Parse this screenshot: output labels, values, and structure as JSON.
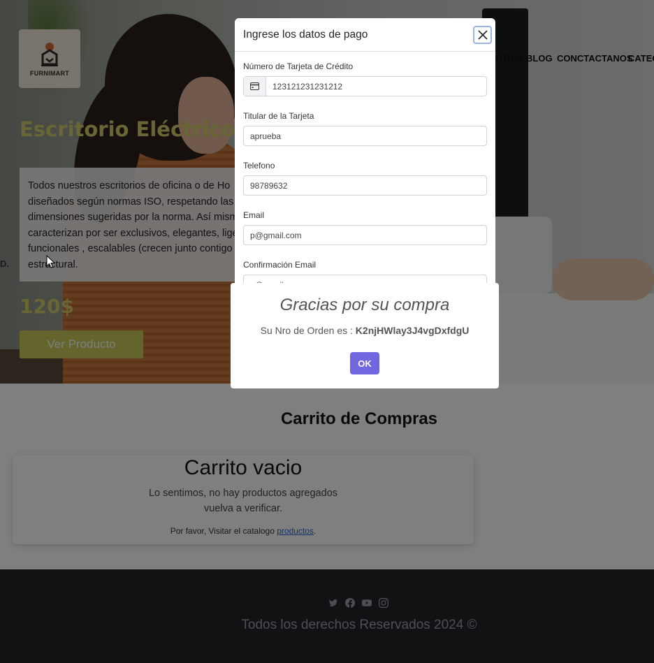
{
  "brand": {
    "name": "FURNIMART"
  },
  "nav": {
    "items": [
      "OTROS",
      "BLOG",
      "CONCTACTANOS",
      "CATEG"
    ]
  },
  "hero": {
    "title": "Escritorio Eléctrico",
    "description_lines": [
      "Todos nuestros escritorios de oficina o de Ho",
      "diseñados según normas ISO, respetando las",
      "dimensiones sugeridas por la norma. Así mism",
      "caracterizan por ser exclusivos, elegantes, lige",
      "funcionales , escalables (crecen junto contigo",
      "estructural."
    ],
    "price": "120$",
    "button_label": "Ver Producto",
    "left_cut_text": "D."
  },
  "cart": {
    "heading": "Carrito de Compras",
    "empty_title": "Carrito vacio",
    "empty_line1": "Lo sentimos, no hay productos agregados",
    "empty_line2": "vuelva a verificar.",
    "hint_prefix": "Por favor, Visitar el catalogo ",
    "hint_link": "productos",
    "hint_suffix": "."
  },
  "footer": {
    "social_icons": [
      "twitter-icon",
      "facebook-icon",
      "youtube-icon",
      "instagram-icon"
    ],
    "copyright": "Todos los derechos Reservados 2024 ©"
  },
  "payment_modal": {
    "title": "Ingrese los datos de pago",
    "fields": {
      "card_number": {
        "label": "Número de Tarjeta de Crédito",
        "value": "123121231231212"
      },
      "card_holder": {
        "label": "Titular de la Tarjeta",
        "value": "aprueba"
      },
      "phone": {
        "label": "Telefono",
        "value": "98789632"
      },
      "email": {
        "label": "Email",
        "value": "p@gmail.com"
      },
      "email_confirm": {
        "label": "Confirmación Email",
        "value": "p@gmail.com"
      }
    }
  },
  "alert": {
    "title": "Gracias por su compra",
    "text_prefix": "Su Nro de Orden es : ",
    "order_id": "K2njHWlay3J4vgDxfdgU",
    "ok_label": "OK"
  },
  "colors": {
    "accent_yellow": "#cfcc68",
    "ok_button": "#7066e0",
    "footer_bg": "#212529",
    "link": "#2563c9"
  }
}
